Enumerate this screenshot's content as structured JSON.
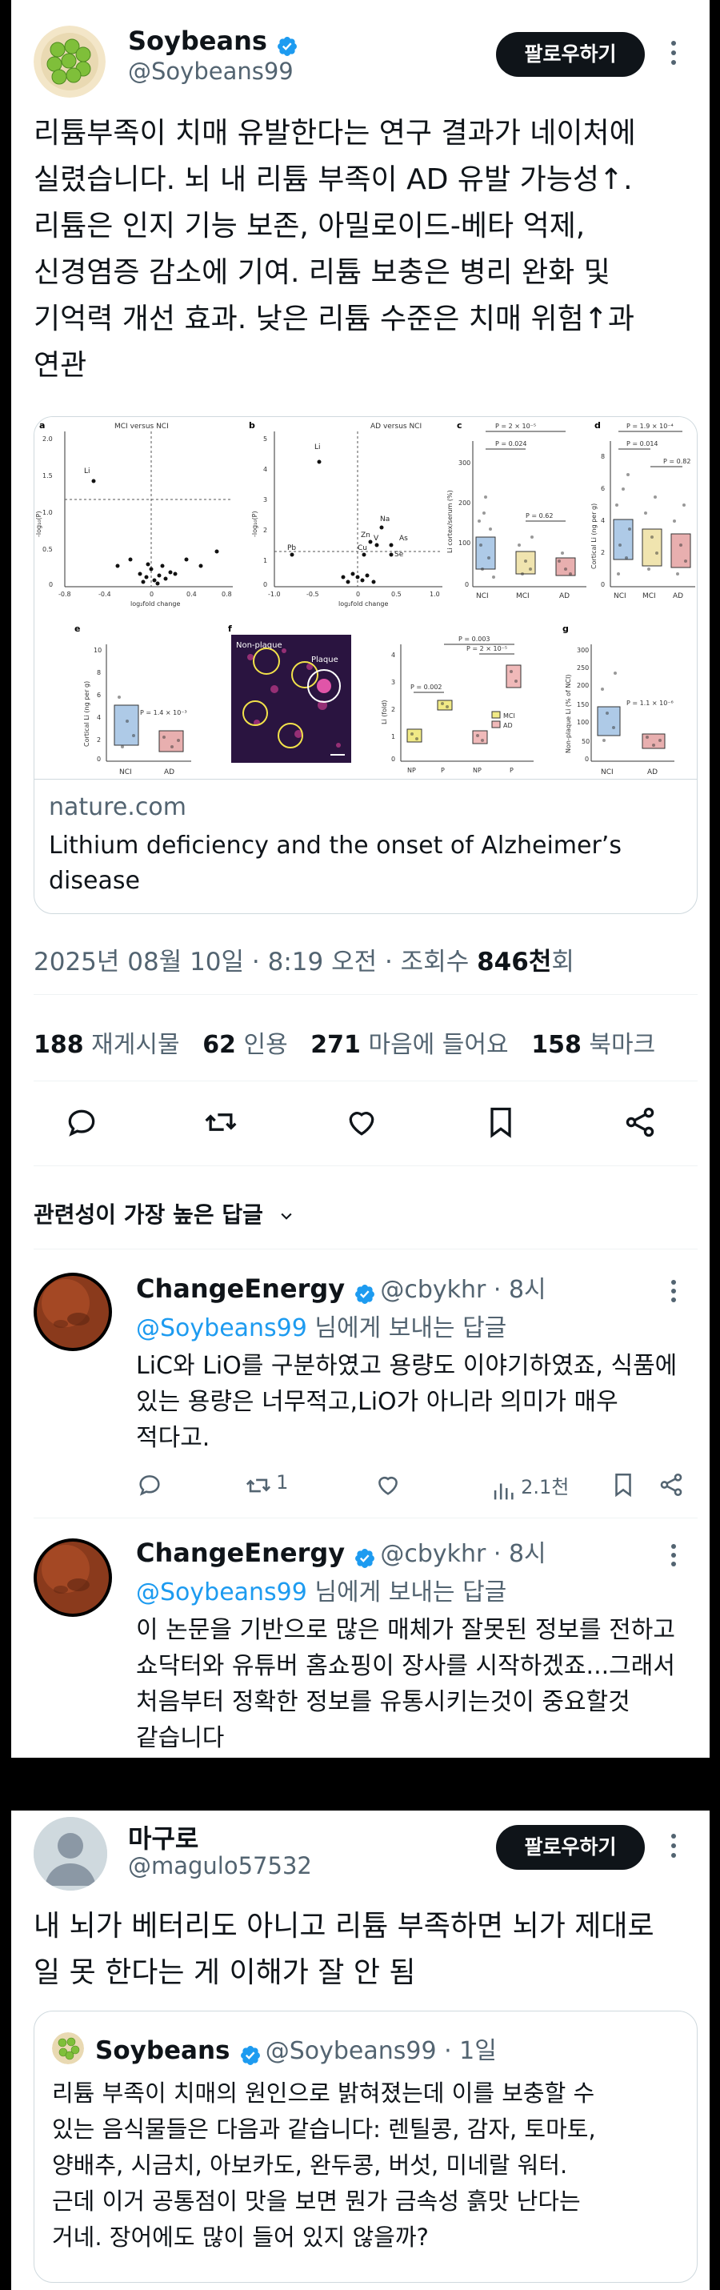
{
  "tweet": {
    "name": "Soybeans",
    "handle": "@Soybeans99",
    "follow_label": "팔로우하기",
    "text_lines": [
      "리튬부족이 치매 유발한다는 연구 결과가 네이처에",
      "실렸습니다. 뇌 내 리튬 부족이 AD 유발 가능성↑.",
      "리튬은 인지 기능 보존, 아밀로이드-베타 억제,",
      "신경염증 감소에 기여. 리튬 보충은 병리 완화 및",
      "기억력 개선 효과. 낮은 리튬 수준은 치매 위험↑과",
      "연관"
    ],
    "link_domain": "nature.com",
    "link_title_lines": [
      "Lithium deficiency and the onset of Alzheimer’s",
      "disease"
    ],
    "meta_prefix": "2025년 08월 10일 · 8:19 오전 · 조회수 ",
    "views": "846천",
    "views_suffix": "회",
    "stats": [
      {
        "count": "188",
        "label": "재게시물"
      },
      {
        "count": "62",
        "label": "인용"
      },
      {
        "count": "271",
        "label": "마음에 들어요"
      },
      {
        "count": "158",
        "label": "북마크"
      }
    ],
    "sort_label": "관련성이 가장 높은 답글"
  },
  "figure": {
    "panel_a": {
      "letter": "a",
      "title": "MCI versus NCI",
      "xlabel": "log₂fold change",
      "ylabel": "-log₁₀(P)",
      "point_label": "Li",
      "yticks": [
        "2.0",
        "1.5",
        "1.0",
        "0.5",
        "0"
      ],
      "xticks": [
        "-0.8",
        "-0.4",
        "0",
        "0.4",
        "0.8"
      ]
    },
    "panel_b": {
      "letter": "b",
      "title": "AD versus NCI",
      "xlabel": "log₂fold change",
      "ylabel": "-log₁₀(P)",
      "labels": [
        "Li",
        "Zn",
        "Na",
        "V",
        "As",
        "Cu",
        "Se",
        "Pb"
      ],
      "yticks": [
        "5",
        "4",
        "3",
        "2",
        "1",
        "0"
      ],
      "xticks": [
        "-1.0",
        "-0.5",
        "0",
        "0.5",
        "1.0"
      ]
    },
    "panel_c": {
      "letter": "c",
      "ylabel": "Li cortex/serum (%)",
      "p_values": [
        "P = 2 × 10⁻⁵",
        "P = 0.024",
        "P = 0.62"
      ],
      "groups": [
        "NCI",
        "MCI",
        "AD"
      ],
      "yticks": [
        "300",
        "200",
        "100",
        "0"
      ]
    },
    "panel_d": {
      "letter": "d",
      "ylabel": "Cortical Li (ng per g)",
      "p_values": [
        "P = 1.9 × 10⁻⁴",
        "P = 0.014",
        "P = 0.82"
      ],
      "groups": [
        "NCI",
        "MCI",
        "AD"
      ],
      "yticks": [
        "8",
        "6",
        "4",
        "2",
        "0"
      ]
    },
    "panel_e": {
      "letter": "e",
      "ylabel": "Cortical Li (ng per g)",
      "p_value": "P = 1.4 × 10⁻³",
      "groups": [
        "NCI",
        "AD"
      ],
      "yticks": [
        "10",
        "8",
        "6",
        "4",
        "2",
        "0"
      ]
    },
    "panel_f": {
      "letter": "f",
      "label_nonplaque": "Non-plaque",
      "label_plaque": "Plaque",
      "ylabel": "Li (fold)",
      "p_values": [
        "P = 0.003",
        "P = 2 × 10⁻⁵",
        "P = 0.002"
      ],
      "groups": [
        "NP",
        "P",
        "NP",
        "P"
      ],
      "legend": [
        "MCI",
        "AD"
      ],
      "yticks": [
        "4",
        "3",
        "2",
        "1",
        "0"
      ]
    },
    "panel_g": {
      "letter": "g",
      "ylabel": "Non-plaque Li (% of NCI)",
      "p_value": "P = 1.1 × 10⁻⁶",
      "groups": [
        "NCI",
        "AD"
      ],
      "yticks": [
        "300",
        "250",
        "200",
        "150",
        "100",
        "50",
        "0"
      ]
    },
    "colors": {
      "nci": "#6b9fd4",
      "mci": "#e6d27a",
      "ad": "#d97a7a"
    }
  },
  "replies": [
    {
      "name": "ChangeEnergy",
      "handle": "@cbykhr · 8시",
      "reply_to_mention": "@Soybeans99",
      "reply_to_suffix": " 님에게 보내는 답글",
      "text_lines": [
        "LiC와 LiO를 구분하였고 용량도 이야기하였죠, 식품에",
        "있는 용량은 너무적고,LiO가 아니라 의미가 매우",
        "적다고."
      ],
      "retweets": "1",
      "views": "2.1천"
    },
    {
      "name": "ChangeEnergy",
      "handle": "@cbykhr · 8시",
      "reply_to_mention": "@Soybeans99",
      "reply_to_suffix": " 님에게 보내는 답글",
      "text_lines": [
        "이 논문을 기반으로 많은 매체가 잘못된 정보를 전하고",
        "쇼닥터와 유튜버 홈쇼핑이 장사를 시작하겠죠...그래서",
        "처음부터 정확한 정보를 유통시키는것이 중요할것",
        "같습니다"
      ]
    }
  ],
  "tweet2": {
    "name": "마구로",
    "handle": "@magulo57532",
    "follow_label": "팔로우하기",
    "text_lines": [
      "내 뇌가 베터리도 아니고 리튬 부족하면 뇌가 제대로",
      "일 못 한다는 게 이해가 잘 안 됨"
    ],
    "quote": {
      "name": "Soybeans",
      "handle": "@Soybeans99 · 1일",
      "text_lines": [
        "리튬 부족이 치매의 원인으로 밝혀졌는데 이를 보충할 수",
        "있는 음식물들은 다음과 같습니다: 렌틸콩, 감자, 토마토,",
        "양배추, 시금치, 아보카도, 완두콩, 버섯,   미네랄 워터.",
        "근데 이거 공통점이 맛을 보면 뭔가 금속성 흙맛 난다는",
        "거네. 장어에도 많이 들어 있지 않을까?"
      ]
    }
  }
}
